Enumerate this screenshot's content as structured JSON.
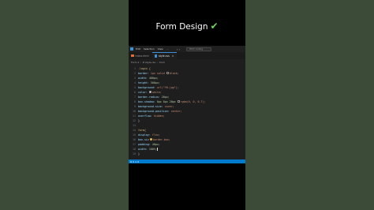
{
  "overlay": {
    "title": "Form Design",
    "check": "✔"
  },
  "menubar": {
    "items": [
      "Edit",
      "Selection",
      "View",
      "···"
    ],
    "arrows": "‹ ›",
    "command_center": "Html coding"
  },
  "tabs": [
    {
      "label": "index.html",
      "icon": "html-file-icon",
      "active": false
    },
    {
      "label": "style.css",
      "icon": "css-file-icon",
      "active": true,
      "close": "×"
    }
  ],
  "breadcrumb": [
    "Form 2",
    "# style.css",
    ".form"
  ],
  "editor": {
    "lines": [
      {
        "n": "1",
        "tokens": [
          {
            "c": "sel",
            "t": ".login {"
          }
        ]
      },
      {
        "n": "2",
        "tokens": [
          {
            "c": "prop",
            "t": "    border: "
          },
          {
            "c": "val",
            "t": "1px solid "
          },
          {
            "c": "sw",
            "color": "#000000"
          },
          {
            "c": "val",
            "t": "black;"
          }
        ]
      },
      {
        "n": "3",
        "tokens": [
          {
            "c": "prop",
            "t": "    width: "
          },
          {
            "c": "num",
            "t": "400px;"
          }
        ]
      },
      {
        "n": "4",
        "tokens": [
          {
            "c": "prop",
            "t": "    height: "
          },
          {
            "c": "num",
            "t": "500px;"
          }
        ]
      },
      {
        "n": "5",
        "tokens": [
          {
            "c": "prop",
            "t": "    background: "
          },
          {
            "c": "val",
            "t": "url(\"f6.jpg\");"
          }
        ]
      },
      {
        "n": "6",
        "tokens": [
          {
            "c": "prop",
            "t": "    color: "
          },
          {
            "c": "sw",
            "color": "#ffffff"
          },
          {
            "c": "val",
            "t": "white;"
          }
        ]
      },
      {
        "n": "7",
        "tokens": [
          {
            "c": "prop",
            "t": "    border-radius: "
          },
          {
            "c": "num",
            "t": "20px;"
          }
        ]
      },
      {
        "n": "8",
        "tokens": [
          {
            "c": "prop",
            "t": "    box-shadow: "
          },
          {
            "c": "num",
            "t": "0px 0px 20px "
          },
          {
            "c": "sw",
            "color": "#000000"
          },
          {
            "c": "val",
            "t": "rgba(0, 0, 0.7);"
          }
        ]
      },
      {
        "n": "9",
        "tokens": [
          {
            "c": "prop",
            "t": "    background-size: "
          },
          {
            "c": "val",
            "t": "cover;"
          }
        ]
      },
      {
        "n": "10",
        "tokens": [
          {
            "c": "prop",
            "t": "    background-position: "
          },
          {
            "c": "val",
            "t": "center;"
          }
        ]
      },
      {
        "n": "11",
        "tokens": [
          {
            "c": "prop",
            "t": "    overflow: "
          },
          {
            "c": "val",
            "t": "hidden;"
          }
        ]
      },
      {
        "n": "12",
        "tokens": [
          {
            "c": "code",
            "t": "}"
          }
        ]
      },
      {
        "n": "13",
        "tokens": []
      },
      {
        "n": "14",
        "tokens": [
          {
            "c": "sel",
            "t": "form{"
          }
        ]
      },
      {
        "n": "15",
        "tokens": [
          {
            "c": "prop",
            "t": "    display: "
          },
          {
            "c": "val",
            "t": "flex;"
          }
        ]
      },
      {
        "n": "16",
        "tokens": [
          {
            "c": "prop",
            "t": "    box-siz"
          },
          {
            "c": "hint"
          },
          {
            "c": "val",
            "t": "border-box;"
          }
        ]
      },
      {
        "n": "17",
        "tokens": [
          {
            "c": "prop",
            "t": "    padding: "
          },
          {
            "c": "num",
            "t": "40px;"
          }
        ]
      },
      {
        "n": "18",
        "tokens": [
          {
            "c": "prop",
            "t": "    width: "
          },
          {
            "c": "num",
            "t": "100%;"
          },
          {
            "c": "cursor"
          }
        ]
      },
      {
        "n": "19",
        "tokens": [
          {
            "c": "code",
            "t": "}"
          }
        ]
      }
    ]
  },
  "statusbar": {
    "left": "⊗ 0 ⚠ 0"
  }
}
